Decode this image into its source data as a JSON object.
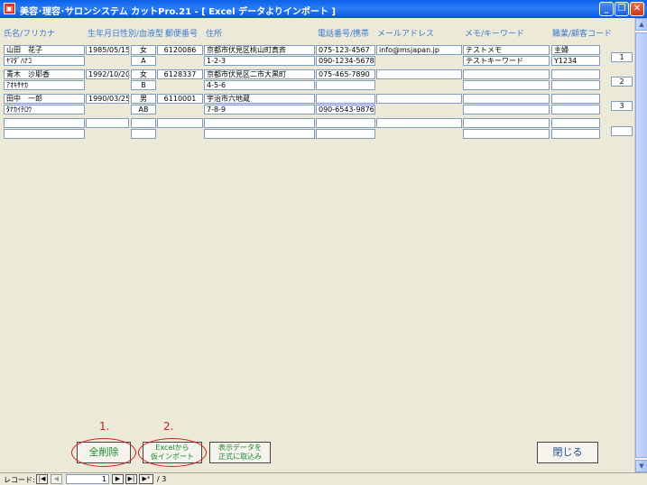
{
  "window": {
    "title": "美容･理容･サロンシステム カットPro.21 - [ Excel データよりインポート ]",
    "app_icon": "access-form-icon",
    "buttons": {
      "minimize": "_",
      "restore": "❐",
      "close": "✕"
    }
  },
  "headers": {
    "name": "氏名/フリカナ",
    "birth": "生年月日",
    "gender_blood": "性別/血液型",
    "zip": "郵便番号",
    "address": "住所",
    "phone": "電話番号/携帯",
    "email": "メールアドレス",
    "memo": "メモ/キーワード",
    "job": "職業/顧客コード"
  },
  "records": [
    {
      "row_button": "1",
      "line1": {
        "name": "山田　花子",
        "birth": "1985/05/15",
        "gender": "女",
        "zip": "6120086",
        "address": "京都市伏見区桃山町真斉",
        "phone": "075-123-4567",
        "email": "info@msjapan.jp",
        "memo": "テストメモ",
        "job": "主婦"
      },
      "line2": {
        "kana": "ﾔﾏﾀﾞﾊﾅｺ",
        "blood": "A",
        "address2": "1-2-3",
        "mobile": "090-1234-5678",
        "keyword": "テストキーワード",
        "code": "Y1234"
      }
    },
    {
      "row_button": "2",
      "line1": {
        "name": "青木　沙耶香",
        "birth": "1992/10/20",
        "gender": "女",
        "zip": "6128337",
        "address": "京都市伏見区二市大黒町",
        "phone": "075-465-7890",
        "email": "",
        "memo": "",
        "job": ""
      },
      "line2": {
        "kana": "ｱｵｷｻﾔｶ",
        "blood": "B",
        "address2": "4-5-6",
        "mobile": "",
        "keyword": "",
        "code": ""
      }
    },
    {
      "row_button": "3",
      "line1": {
        "name": "田中　一郎",
        "birth": "1990/03/25",
        "gender": "男",
        "zip": "6110001",
        "address": "宇治市六地蔵",
        "phone": "",
        "email": "",
        "memo": "",
        "job": ""
      },
      "line2": {
        "kana": "ﾀﾅｶｲﾁﾛｳ",
        "blood": "AB",
        "address2": "7-8-9",
        "mobile": "090-6543-9876",
        "keyword": "",
        "code": ""
      }
    },
    {
      "row_button": "",
      "line1": {
        "name": "",
        "birth": "",
        "gender": "",
        "zip": "",
        "address": "",
        "phone": "",
        "email": "",
        "memo": "",
        "job": ""
      },
      "line2": {
        "kana": "",
        "blood": "",
        "address2": "",
        "mobile": "",
        "keyword": "",
        "code": ""
      }
    }
  ],
  "annotations": {
    "step1": "1.",
    "step2": "2."
  },
  "actions": {
    "delete_all": "全削除",
    "import_line1": "Excelから",
    "import_line2": "仮インポート",
    "commit_line1": "表示データを",
    "commit_line2": "正式に取込み",
    "close": "閉じる"
  },
  "navigation": {
    "label": "レコード:",
    "current": "1",
    "total": "/ 3",
    "first": "|◀",
    "prev": "◀",
    "next": "▶",
    "last": "▶|",
    "new": "▶*"
  },
  "colors": {
    "header_text": "#3b7bd4",
    "button_text": "#1a8a2a",
    "annotation": "#d02020"
  }
}
